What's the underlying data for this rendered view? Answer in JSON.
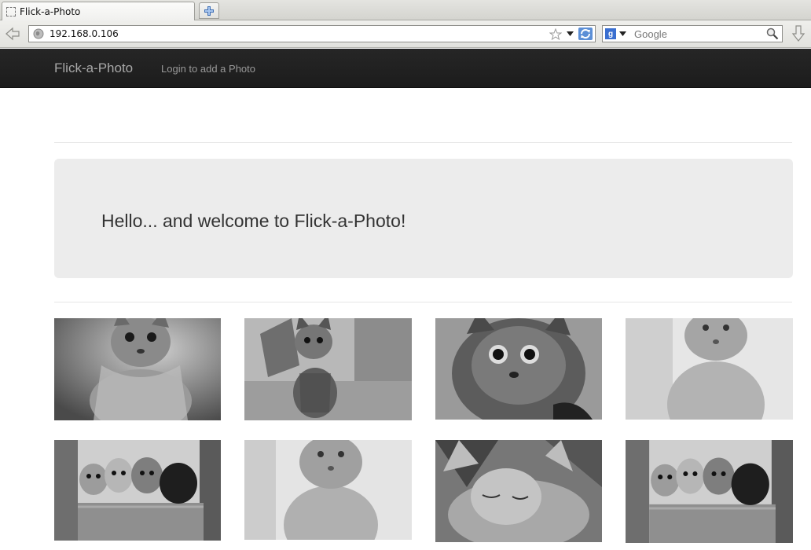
{
  "browser": {
    "tab_title": "Flick-a-Photo",
    "url": "192.168.0.106",
    "search_placeholder": "Google",
    "search_engine_icon": "g",
    "icons": [
      "back-arrow-icon",
      "globe-icon",
      "bookmark-star-icon",
      "dropdown-arrow-icon",
      "reload-icon",
      "search-engine-icon",
      "magnifier-icon",
      "download-icon",
      "new-tab-icon"
    ]
  },
  "site": {
    "brand": "Flick-a-Photo",
    "nav_login": "Login to add a Photo",
    "hero_message": "Hello... and welcome to Flick-a-Photo!"
  },
  "photos": [
    {
      "name": "kitten-photo-1",
      "subject": "tabby kitten portrait"
    },
    {
      "name": "kitten-photo-2",
      "subject": "tabby kitten sitting by flower pot"
    },
    {
      "name": "kitten-photo-3",
      "subject": "wide-eyed kitten close-up"
    },
    {
      "name": "kitten-photo-4",
      "subject": "light kitten on bright background"
    },
    {
      "name": "kitten-photo-5",
      "subject": "four kittens in a basket"
    },
    {
      "name": "kitten-photo-6",
      "subject": "light kitten on bright background"
    },
    {
      "name": "kitten-photo-7",
      "subject": "kitten stretching with paws up"
    },
    {
      "name": "kitten-photo-8",
      "subject": "four kittens in a basket"
    }
  ]
}
